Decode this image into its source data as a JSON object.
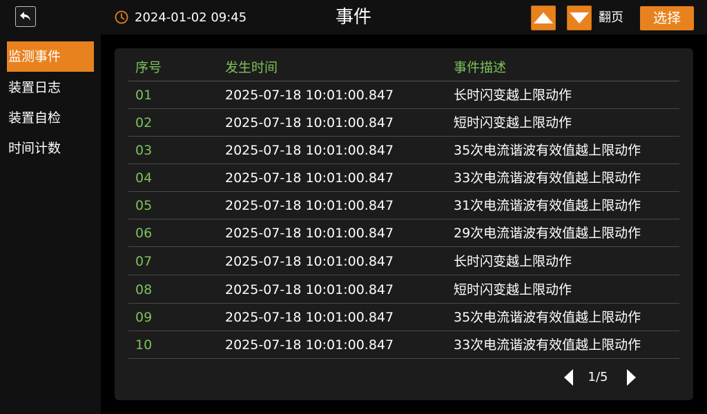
{
  "header": {
    "datetime": "2024-01-02 09:45",
    "title": "事件",
    "page_turn_label": "翻页",
    "select_label": "选择",
    "accent_color": "#e8821e",
    "icons": [
      "back-arrow-icon",
      "clock-icon",
      "arrow-up-icon",
      "arrow-down-icon"
    ]
  },
  "sidebar": {
    "items": [
      {
        "label": "监测事件",
        "active": true
      },
      {
        "label": "装置日志",
        "active": false
      },
      {
        "label": "装置自检",
        "active": false
      },
      {
        "label": "时间计数",
        "active": false
      }
    ]
  },
  "table": {
    "columns": [
      "序号",
      "发生时间",
      "事件描述"
    ],
    "rows": [
      {
        "no": "01",
        "time": "2025-07-18  10:01:00.847",
        "desc": "长时闪变越上限动作"
      },
      {
        "no": "02",
        "time": "2025-07-18  10:01:00.847",
        "desc": "短时闪变越上限动作"
      },
      {
        "no": "03",
        "time": "2025-07-18  10:01:00.847",
        "desc": "35次电流谐波有效值越上限动作"
      },
      {
        "no": "04",
        "time": "2025-07-18  10:01:00.847",
        "desc": "33次电流谐波有效值越上限动作"
      },
      {
        "no": "05",
        "time": "2025-07-18  10:01:00.847",
        "desc": "31次电流谐波有效值越上限动作"
      },
      {
        "no": "06",
        "time": "2025-07-18  10:01:00.847",
        "desc": "29次电流谐波有效值越上限动作"
      },
      {
        "no": "07",
        "time": "2025-07-18  10:01:00.847",
        "desc": "长时闪变越上限动作"
      },
      {
        "no": "08",
        "time": "2025-07-18  10:01:00.847",
        "desc": "短时闪变越上限动作"
      },
      {
        "no": "09",
        "time": "2025-07-18  10:01:00.847",
        "desc": "35次电流谐波有效值越上限动作"
      },
      {
        "no": "10",
        "time": "2025-07-18  10:01:00.847",
        "desc": "33次电流谐波有效值越上限动作"
      }
    ]
  },
  "pager": {
    "label": "1/5"
  }
}
